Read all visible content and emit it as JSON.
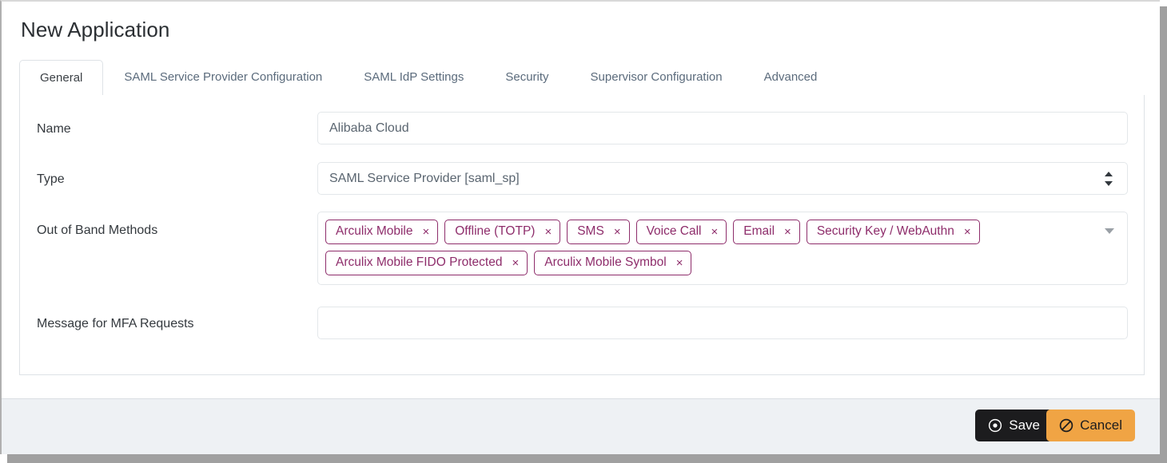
{
  "window": {
    "title": "New Application"
  },
  "tabs": [
    {
      "label": "General",
      "active": true
    },
    {
      "label": "SAML Service Provider Configuration",
      "active": false
    },
    {
      "label": "SAML IdP Settings",
      "active": false
    },
    {
      "label": "Security",
      "active": false
    },
    {
      "label": "Supervisor Configuration",
      "active": false
    },
    {
      "label": "Advanced",
      "active": false
    }
  ],
  "form": {
    "name": {
      "label": "Name",
      "value": "Alibaba Cloud",
      "placeholder": "Alibaba Cloud"
    },
    "type": {
      "label": "Type",
      "value": "SAML Service Provider [saml_sp]",
      "options": [
        "SAML Service Provider [saml_sp]"
      ]
    },
    "out_of_band_methods": {
      "label": "Out of Band Methods",
      "tags": [
        "Arculix Mobile",
        "Offline (TOTP)",
        "SMS",
        "Voice Call",
        "Email",
        "Security Key / WebAuthn",
        "Arculix Mobile FIDO Protected",
        "Arculix Mobile Symbol"
      ],
      "remove_glyph": "×",
      "dropdown_icon": "chevron-down-icon"
    },
    "mfa_message": {
      "label": "Message for MFA Requests",
      "value": "",
      "placeholder": ""
    }
  },
  "footer": {
    "save": {
      "label": "Save",
      "icon": "dot-circle-icon"
    },
    "cancel": {
      "label": "Cancel",
      "icon": "ban-icon"
    }
  },
  "colors": {
    "tag_accent": "#8e2d6b",
    "save_bg": "#1c1c1e",
    "cancel_bg": "#f0a444",
    "footer_bg": "#eef1f4",
    "border": "#dee2e6"
  }
}
